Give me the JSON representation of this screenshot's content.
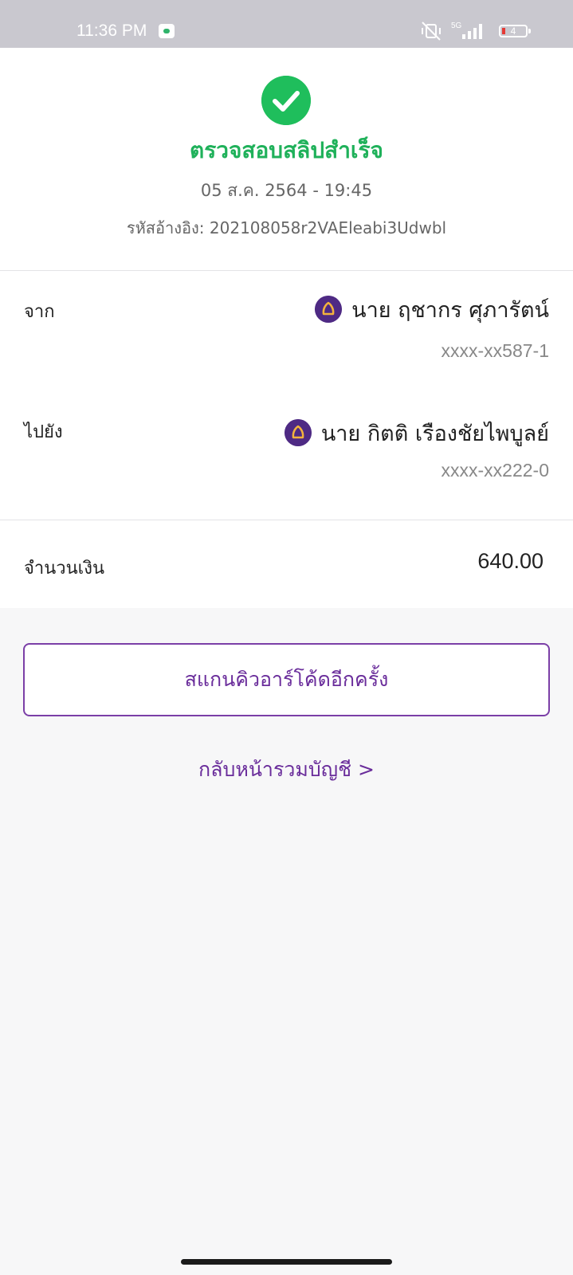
{
  "status_bar": {
    "time": "11:36 PM",
    "network": "5G",
    "battery_level": "4"
  },
  "result": {
    "title": "ตรวจสอบสลิปสำเร็จ",
    "datetime": "05 ส.ค. 2564 - 19:45",
    "reference": "รหัสอ้างอิง: 202108058r2VAEleabi3Udwbl"
  },
  "from": {
    "label": "จาก",
    "name": "นาย ฤชากร ศุภารัตน์",
    "account": "xxxx-xx587-1"
  },
  "to": {
    "label": "ไปยัง",
    "name": "นาย กิตติ เรืองชัยไพบูลย์",
    "account": "xxxx-xx222-0"
  },
  "amount": {
    "label": "จำนวนเงิน",
    "value": "640.00"
  },
  "actions": {
    "scan_again": "สแกนคิวอาร์โค้ดอีกครั้ง",
    "back_to_accounts": "กลับหน้ารวมบัญชี >"
  },
  "colors": {
    "success": "#1fb15a",
    "brand_purple": "#6a2d9b",
    "bank_icon": "#4e2a84"
  }
}
